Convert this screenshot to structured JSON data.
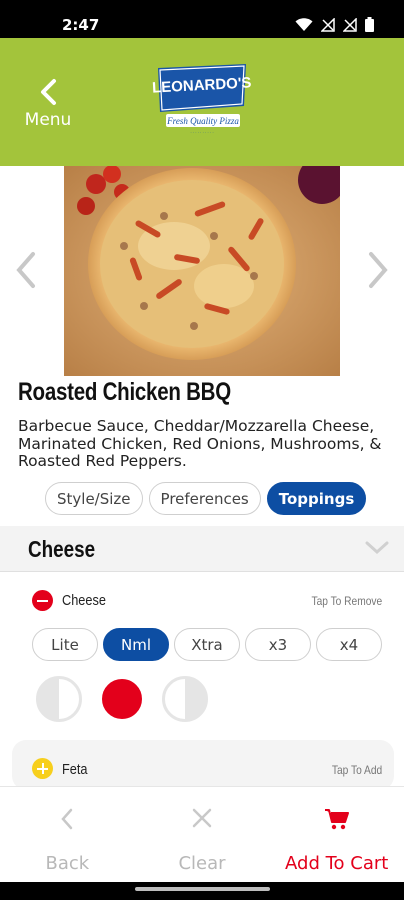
{
  "status_bar": {
    "time": "2:47"
  },
  "header": {
    "menu_label": "Menu",
    "logo": {
      "brand": "LEONARDO'S",
      "tagline": "Fresh Quality Pizza"
    }
  },
  "product": {
    "title": "Roasted Chicken BBQ",
    "description": "Barbecue Sauce, Cheddar/Mozzarella Cheese, Marinated Chicken, Red Onions, Mushrooms, & Roasted Red Peppers."
  },
  "tabs": [
    {
      "label": "Style/Size",
      "active": false
    },
    {
      "label": "Preferences",
      "active": false
    },
    {
      "label": "Toppings",
      "active": true
    }
  ],
  "section": {
    "title": "Cheese"
  },
  "toppings": [
    {
      "name": "Cheese",
      "hint": "Tap To Remove",
      "amounts": [
        {
          "label": "Lite",
          "active": false
        },
        {
          "label": "Nml",
          "active": true
        },
        {
          "label": "Xtra",
          "active": false
        },
        {
          "label": "x3",
          "active": false
        },
        {
          "label": "x4",
          "active": false
        }
      ],
      "placement": "whole"
    },
    {
      "name": "Feta",
      "hint": "Tap To Add"
    }
  ],
  "bottom_bar": {
    "back_label": "Back",
    "clear_label": "Clear",
    "cart_label": "Add To Cart"
  },
  "colors": {
    "header_green": "#a3c43b",
    "active_blue": "#0d4ea3",
    "accent_red": "#e3001b",
    "add_yellow": "#f7cf1d"
  }
}
